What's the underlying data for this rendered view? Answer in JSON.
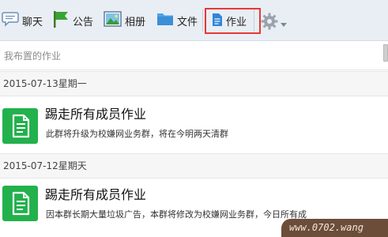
{
  "toolbar": {
    "chat_label": "聊天",
    "notice_label": "公告",
    "album_label": "相册",
    "file_label": "文件",
    "homework_label": "作业"
  },
  "search": {
    "placeholder": "我布置的作业"
  },
  "groups": [
    {
      "date": "2015-07-13星期一",
      "item": {
        "title": "踢走所有成员作业",
        "desc": "此群将升级为校嫌网业务群，将在今明两天清群"
      }
    },
    {
      "date": "2015-07-12星期天",
      "item": {
        "title": "踢走所有成员作业",
        "desc": "因本群长期大量垃圾广告，本群将修改为校嫌网业务群，今日所有成"
      }
    }
  ],
  "watermark": "www.0702.wang",
  "colors": {
    "toolbar_bg": "#e9eef4",
    "highlight_border": "#e53935",
    "homework_icon": "#22b14c",
    "date_row_bg": "#f6f6f6"
  },
  "icons": {
    "chat": "chat-bubble-icon",
    "notice": "flag-icon",
    "album": "picture-icon",
    "file": "folder-icon",
    "homework": "document-icon",
    "settings": "gear-icon",
    "dropdown": "caret-down-icon",
    "homework_item": "homework-document-icon"
  }
}
